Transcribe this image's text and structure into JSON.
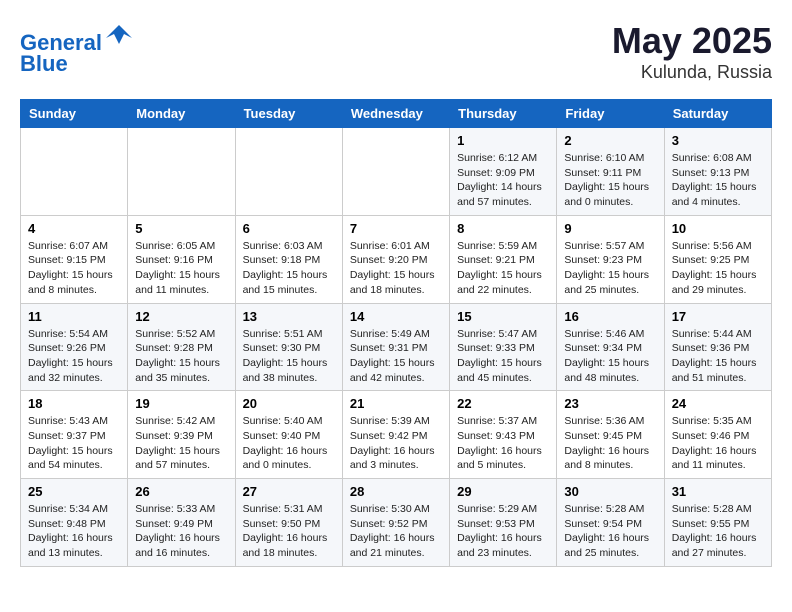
{
  "header": {
    "logo_line1": "General",
    "logo_line2": "Blue",
    "title": "May 2025",
    "subtitle": "Kulunda, Russia"
  },
  "calendar": {
    "days_of_week": [
      "Sunday",
      "Monday",
      "Tuesday",
      "Wednesday",
      "Thursday",
      "Friday",
      "Saturday"
    ],
    "weeks": [
      [
        {
          "day": "",
          "info": ""
        },
        {
          "day": "",
          "info": ""
        },
        {
          "day": "",
          "info": ""
        },
        {
          "day": "",
          "info": ""
        },
        {
          "day": "1",
          "info": "Sunrise: 6:12 AM\nSunset: 9:09 PM\nDaylight: 14 hours\nand 57 minutes."
        },
        {
          "day": "2",
          "info": "Sunrise: 6:10 AM\nSunset: 9:11 PM\nDaylight: 15 hours\nand 0 minutes."
        },
        {
          "day": "3",
          "info": "Sunrise: 6:08 AM\nSunset: 9:13 PM\nDaylight: 15 hours\nand 4 minutes."
        }
      ],
      [
        {
          "day": "4",
          "info": "Sunrise: 6:07 AM\nSunset: 9:15 PM\nDaylight: 15 hours\nand 8 minutes."
        },
        {
          "day": "5",
          "info": "Sunrise: 6:05 AM\nSunset: 9:16 PM\nDaylight: 15 hours\nand 11 minutes."
        },
        {
          "day": "6",
          "info": "Sunrise: 6:03 AM\nSunset: 9:18 PM\nDaylight: 15 hours\nand 15 minutes."
        },
        {
          "day": "7",
          "info": "Sunrise: 6:01 AM\nSunset: 9:20 PM\nDaylight: 15 hours\nand 18 minutes."
        },
        {
          "day": "8",
          "info": "Sunrise: 5:59 AM\nSunset: 9:21 PM\nDaylight: 15 hours\nand 22 minutes."
        },
        {
          "day": "9",
          "info": "Sunrise: 5:57 AM\nSunset: 9:23 PM\nDaylight: 15 hours\nand 25 minutes."
        },
        {
          "day": "10",
          "info": "Sunrise: 5:56 AM\nSunset: 9:25 PM\nDaylight: 15 hours\nand 29 minutes."
        }
      ],
      [
        {
          "day": "11",
          "info": "Sunrise: 5:54 AM\nSunset: 9:26 PM\nDaylight: 15 hours\nand 32 minutes."
        },
        {
          "day": "12",
          "info": "Sunrise: 5:52 AM\nSunset: 9:28 PM\nDaylight: 15 hours\nand 35 minutes."
        },
        {
          "day": "13",
          "info": "Sunrise: 5:51 AM\nSunset: 9:30 PM\nDaylight: 15 hours\nand 38 minutes."
        },
        {
          "day": "14",
          "info": "Sunrise: 5:49 AM\nSunset: 9:31 PM\nDaylight: 15 hours\nand 42 minutes."
        },
        {
          "day": "15",
          "info": "Sunrise: 5:47 AM\nSunset: 9:33 PM\nDaylight: 15 hours\nand 45 minutes."
        },
        {
          "day": "16",
          "info": "Sunrise: 5:46 AM\nSunset: 9:34 PM\nDaylight: 15 hours\nand 48 minutes."
        },
        {
          "day": "17",
          "info": "Sunrise: 5:44 AM\nSunset: 9:36 PM\nDaylight: 15 hours\nand 51 minutes."
        }
      ],
      [
        {
          "day": "18",
          "info": "Sunrise: 5:43 AM\nSunset: 9:37 PM\nDaylight: 15 hours\nand 54 minutes."
        },
        {
          "day": "19",
          "info": "Sunrise: 5:42 AM\nSunset: 9:39 PM\nDaylight: 15 hours\nand 57 minutes."
        },
        {
          "day": "20",
          "info": "Sunrise: 5:40 AM\nSunset: 9:40 PM\nDaylight: 16 hours\nand 0 minutes."
        },
        {
          "day": "21",
          "info": "Sunrise: 5:39 AM\nSunset: 9:42 PM\nDaylight: 16 hours\nand 3 minutes."
        },
        {
          "day": "22",
          "info": "Sunrise: 5:37 AM\nSunset: 9:43 PM\nDaylight: 16 hours\nand 5 minutes."
        },
        {
          "day": "23",
          "info": "Sunrise: 5:36 AM\nSunset: 9:45 PM\nDaylight: 16 hours\nand 8 minutes."
        },
        {
          "day": "24",
          "info": "Sunrise: 5:35 AM\nSunset: 9:46 PM\nDaylight: 16 hours\nand 11 minutes."
        }
      ],
      [
        {
          "day": "25",
          "info": "Sunrise: 5:34 AM\nSunset: 9:48 PM\nDaylight: 16 hours\nand 13 minutes."
        },
        {
          "day": "26",
          "info": "Sunrise: 5:33 AM\nSunset: 9:49 PM\nDaylight: 16 hours\nand 16 minutes."
        },
        {
          "day": "27",
          "info": "Sunrise: 5:31 AM\nSunset: 9:50 PM\nDaylight: 16 hours\nand 18 minutes."
        },
        {
          "day": "28",
          "info": "Sunrise: 5:30 AM\nSunset: 9:52 PM\nDaylight: 16 hours\nand 21 minutes."
        },
        {
          "day": "29",
          "info": "Sunrise: 5:29 AM\nSunset: 9:53 PM\nDaylight: 16 hours\nand 23 minutes."
        },
        {
          "day": "30",
          "info": "Sunrise: 5:28 AM\nSunset: 9:54 PM\nDaylight: 16 hours\nand 25 minutes."
        },
        {
          "day": "31",
          "info": "Sunrise: 5:28 AM\nSunset: 9:55 PM\nDaylight: 16 hours\nand 27 minutes."
        }
      ]
    ]
  }
}
